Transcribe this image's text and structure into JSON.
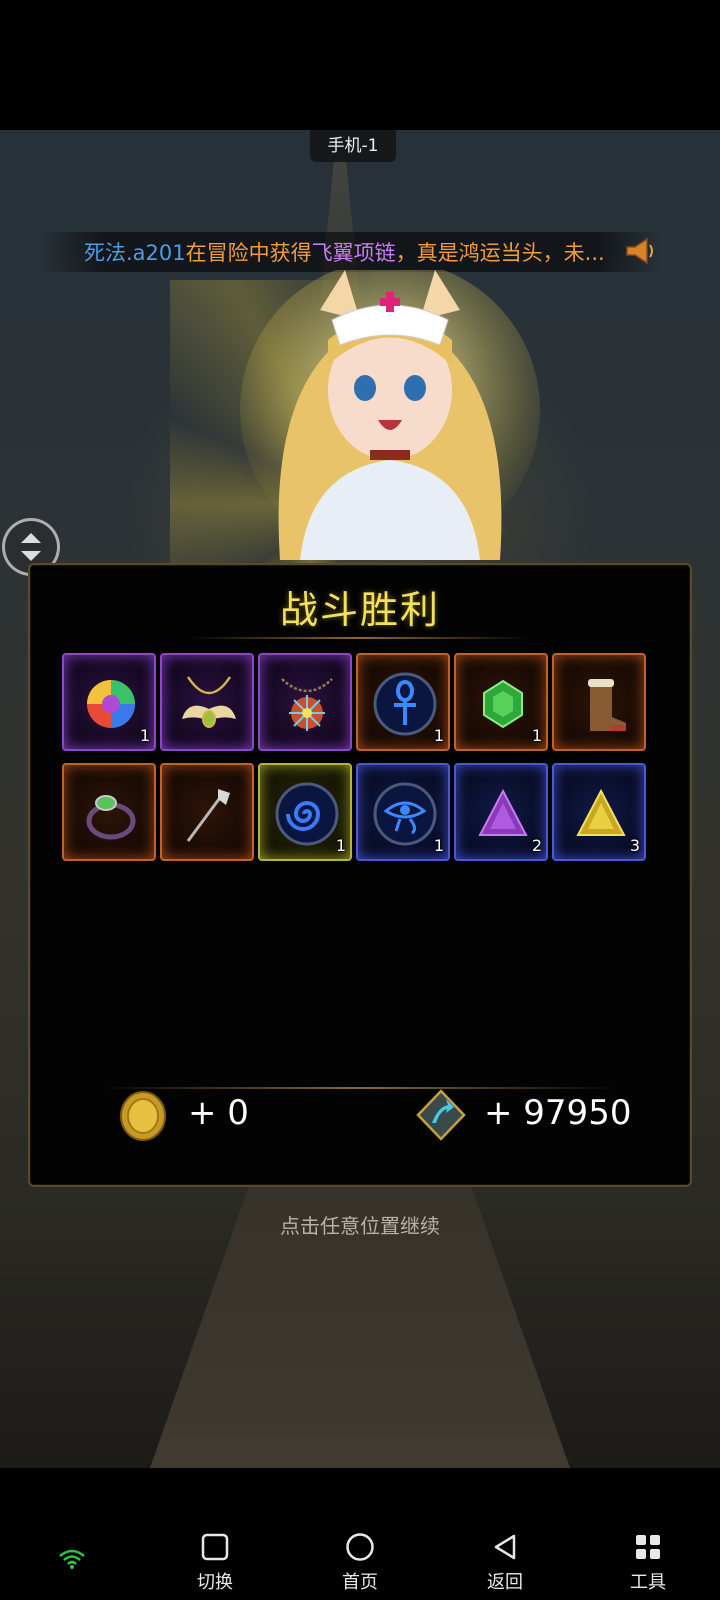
{
  "device": {
    "label": "手机-1"
  },
  "broadcast": {
    "player": "死法.a201",
    "text_before": "在冒险中获得",
    "item": "飞翼项链",
    "text_after": "，真是鸿运当头，未..."
  },
  "result": {
    "title": "战斗胜利",
    "items": [
      {
        "name": "rainbow-orb",
        "rarity": "purple",
        "qty": "1"
      },
      {
        "name": "winged-necklace",
        "rarity": "purple",
        "qty": ""
      },
      {
        "name": "jeweled-necklace",
        "rarity": "purple",
        "qty": ""
      },
      {
        "name": "ankh-rune",
        "rarity": "orange",
        "qty": "1"
      },
      {
        "name": "green-gem",
        "rarity": "orange",
        "qty": "1"
      },
      {
        "name": "fur-boots",
        "rarity": "orange",
        "qty": ""
      },
      {
        "name": "green-ring",
        "rarity": "orange",
        "qty": ""
      },
      {
        "name": "staff",
        "rarity": "orange",
        "qty": ""
      },
      {
        "name": "spiral-rune",
        "rarity": "yellow",
        "qty": "1"
      },
      {
        "name": "eye-rune",
        "rarity": "blue",
        "qty": "1"
      },
      {
        "name": "purple-crystal",
        "rarity": "blue",
        "qty": "2"
      },
      {
        "name": "yellow-crystal",
        "rarity": "blue",
        "qty": "3"
      }
    ],
    "gold_gain": "+ 0",
    "exp_gain": "+ 97950"
  },
  "hint": "点击任意位置继续",
  "navbar": {
    "switch_label": "切换",
    "home_label": "首页",
    "back_label": "返回",
    "tools_label": "工具"
  },
  "colors": {
    "title": "#f2e25a",
    "player": "#4f9be6",
    "announce": "#f29c3b",
    "item_highlight": "#c77cf0"
  }
}
